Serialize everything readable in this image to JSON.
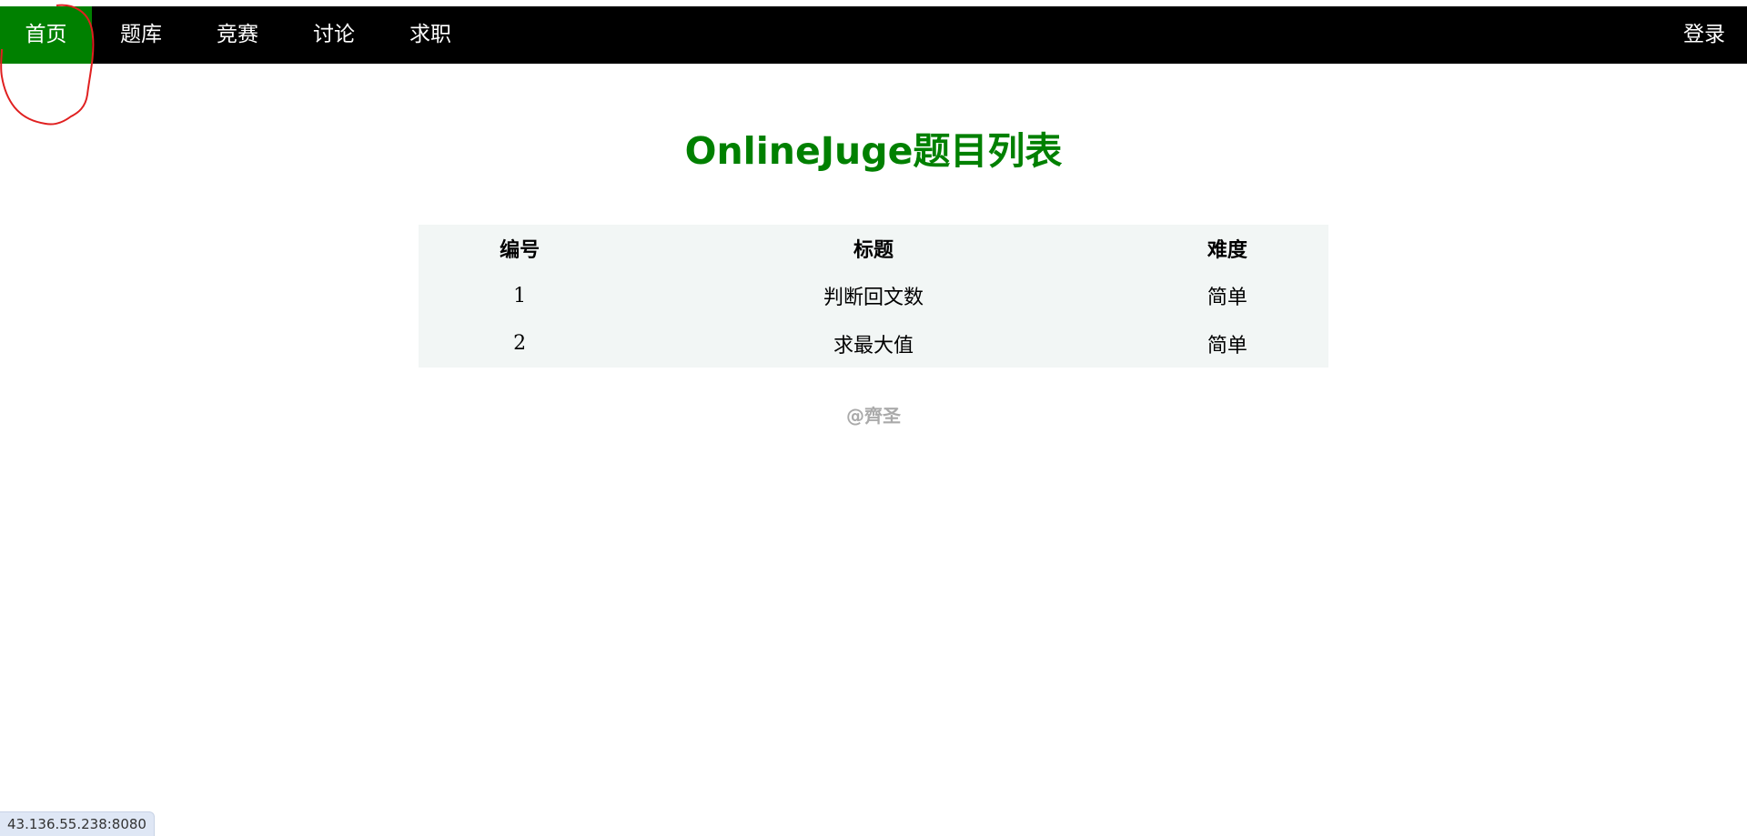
{
  "nav": {
    "items": [
      {
        "label": "首页"
      },
      {
        "label": "题库"
      },
      {
        "label": "竞赛"
      },
      {
        "label": "讨论"
      },
      {
        "label": "求职"
      }
    ],
    "login_label": "登录"
  },
  "page": {
    "title": "OnlineJuge题目列表"
  },
  "table": {
    "headers": [
      "编号",
      "标题",
      "难度"
    ],
    "rows": [
      {
        "id": "1",
        "title": "判断回文数",
        "difficulty": "简单"
      },
      {
        "id": "2",
        "title": "求最大值",
        "difficulty": "简单"
      }
    ]
  },
  "footer": {
    "text": "@齊圣"
  },
  "status_bar": {
    "url": "43.136.55.238:8080"
  },
  "colors": {
    "accent": "#008000",
    "nav_bg": "#000000",
    "table_bg": "#f2f6f5",
    "annotation": "#e02020"
  }
}
